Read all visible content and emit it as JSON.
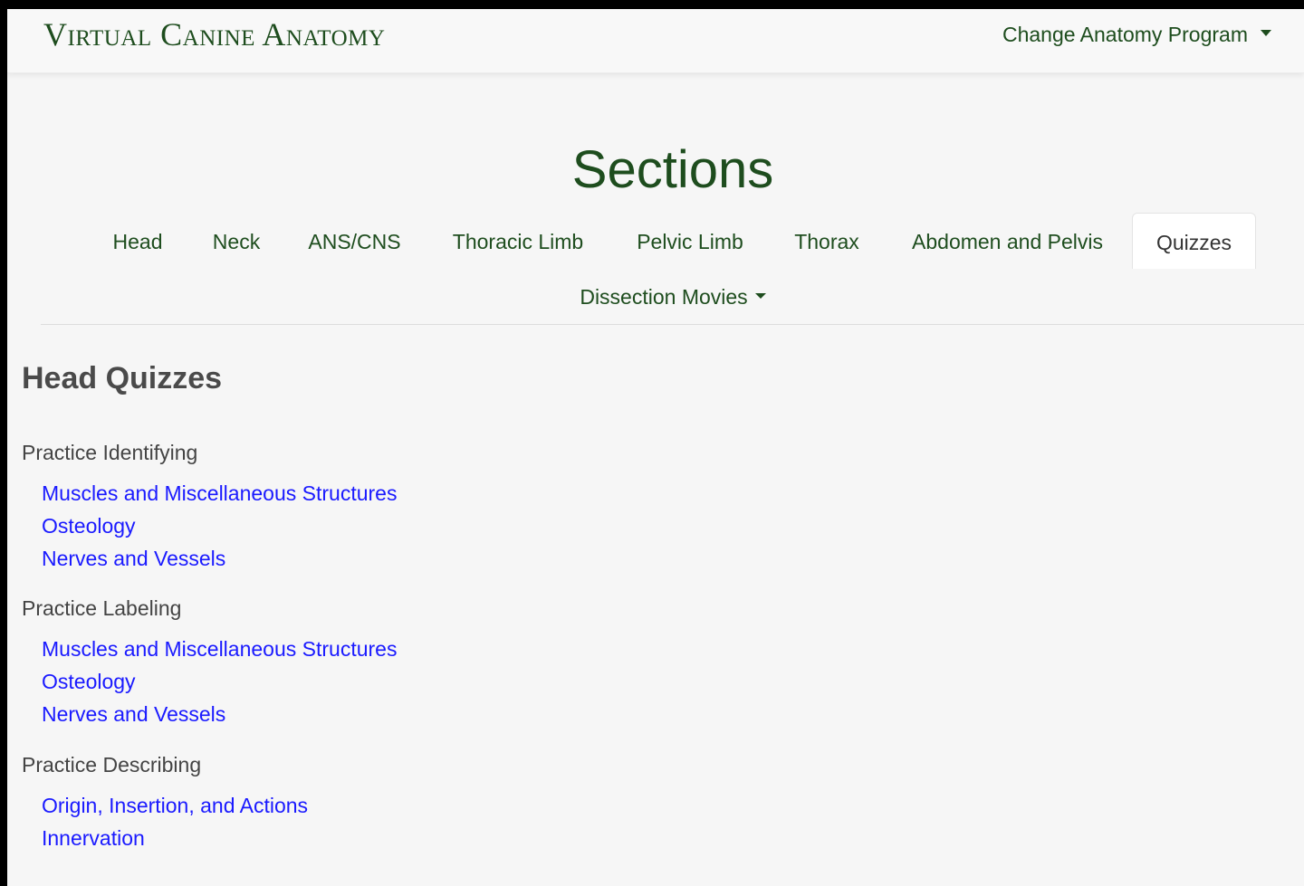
{
  "navbar": {
    "brand": "Virtual Canine Anatomy",
    "program_menu_label": "Change Anatomy Program",
    "program_menu_icon": "caret-down-icon"
  },
  "sections": {
    "title": "Sections",
    "tabs": [
      {
        "label": "Head"
      },
      {
        "label": "Neck"
      },
      {
        "label": "ANS/CNS"
      },
      {
        "label": "Thoracic Limb"
      },
      {
        "label": "Pelvic Limb"
      },
      {
        "label": "Thorax"
      },
      {
        "label": "Abdomen and Pelvis"
      },
      {
        "label": "Quizzes",
        "active": true
      }
    ],
    "dissection_movies_label": "Dissection Movies",
    "dissection_movies_icon": "caret-down-icon"
  },
  "quizzes": {
    "heading": "Head Quizzes",
    "groups": [
      {
        "label": "Practice Identifying",
        "links": [
          "Muscles and Miscellaneous Structures",
          "Osteology",
          "Nerves and Vessels"
        ]
      },
      {
        "label": "Practice Labeling",
        "links": [
          "Muscles and Miscellaneous Structures",
          "Osteology",
          "Nerves and Vessels"
        ]
      },
      {
        "label": "Practice Describing",
        "links": [
          "Origin, Insertion, and Actions",
          "Innervation"
        ]
      }
    ]
  },
  "colors": {
    "brand_green": "#1e4d1e",
    "link_blue": "#1a1aff",
    "page_background": "#f6f6f6"
  }
}
